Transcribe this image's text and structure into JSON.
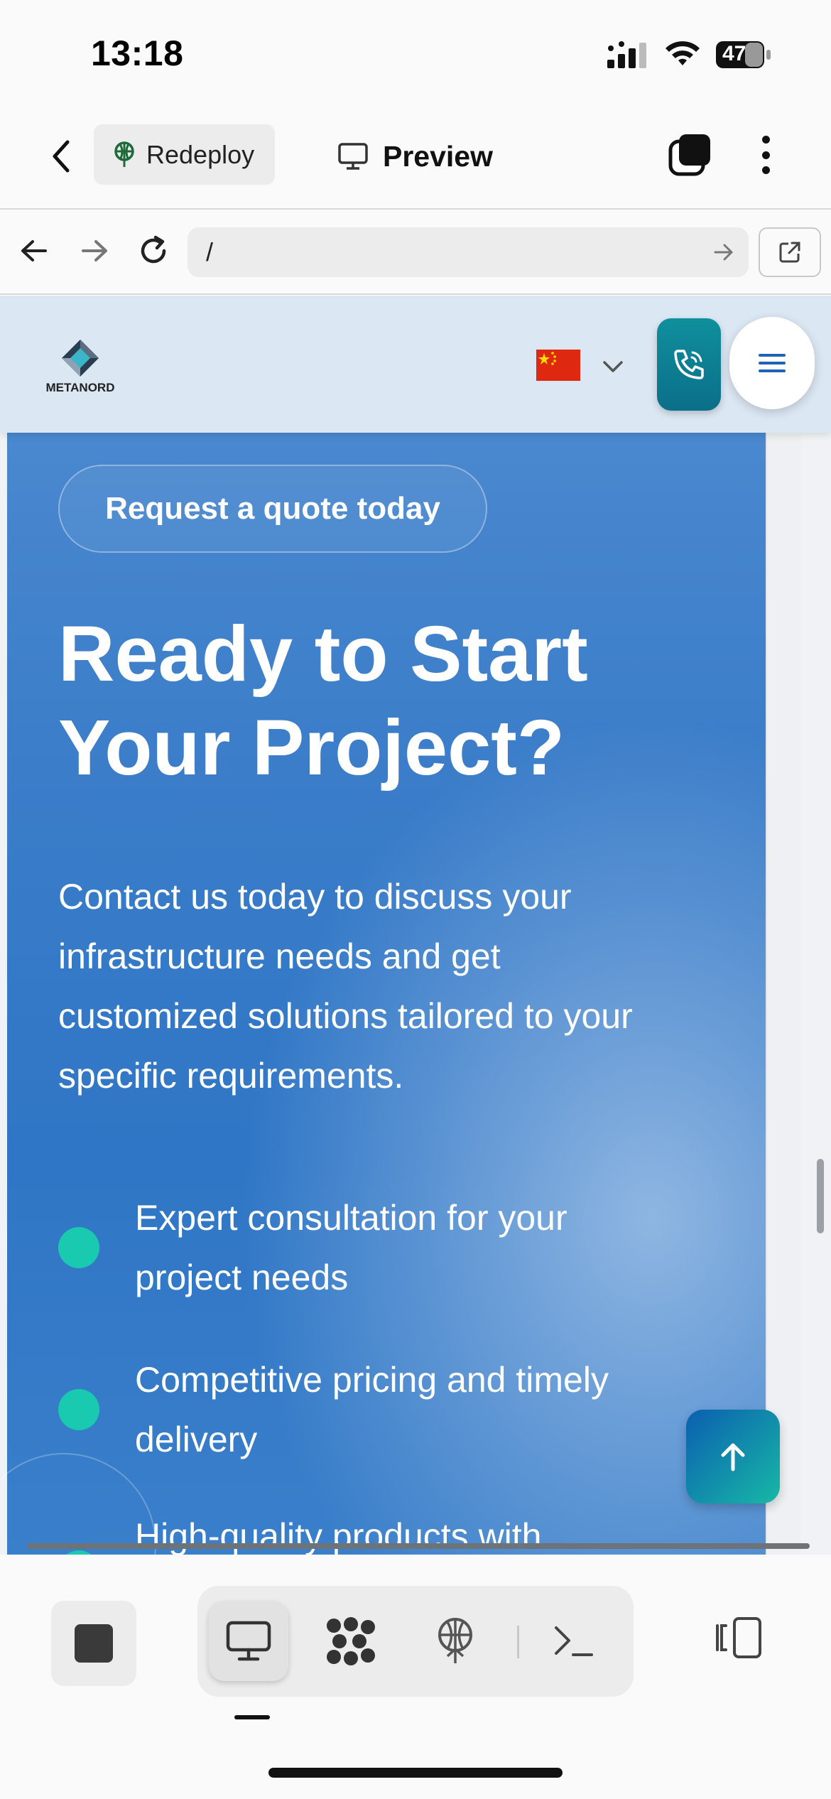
{
  "status_bar": {
    "time": "13:18",
    "battery": "47"
  },
  "app_toolbar": {
    "redeploy_label": "Redeploy",
    "preview_label": "Preview"
  },
  "browser": {
    "url": "/"
  },
  "site": {
    "logo_text": "METANORD",
    "hero": {
      "quote_pill": "Request a quote today",
      "title_line1": "Ready to Start",
      "title_line2": "Your Project?",
      "description_lines": [
        "Contact us today to discuss your",
        "infrastructure needs and get",
        "customized solutions tailored to your",
        "specific requirements."
      ],
      "features": [
        {
          "line1": "Expert consultation for your",
          "line2": "project needs"
        },
        {
          "line1": "Competitive pricing and timely",
          "line2": "delivery"
        },
        {
          "line1": "High-quality products with",
          "line2": ""
        }
      ]
    }
  },
  "colors": {
    "accent_teal": "#19c9b0",
    "hero_blue": "#3b7dc9",
    "header_bg": "#dbe7f3",
    "flag_red": "#de2910"
  },
  "icons": {
    "back": "chevron-left-icon",
    "redeploy": "antenna-icon",
    "preview": "monitor-icon",
    "tabs": "tabs-icon",
    "more": "more-vertical-icon",
    "nav_back": "arrow-left-icon",
    "nav_forward": "arrow-right-icon",
    "reload": "reload-icon",
    "open_external": "external-link-icon",
    "phone": "phone-icon",
    "menu": "hamburger-menu-icon",
    "scroll_top": "arrow-up-icon",
    "stop": "stop-icon",
    "agents": "cluster-icon",
    "deploy": "antenna-icon",
    "terminal": "terminal-icon",
    "panel": "panel-toggle-icon"
  }
}
